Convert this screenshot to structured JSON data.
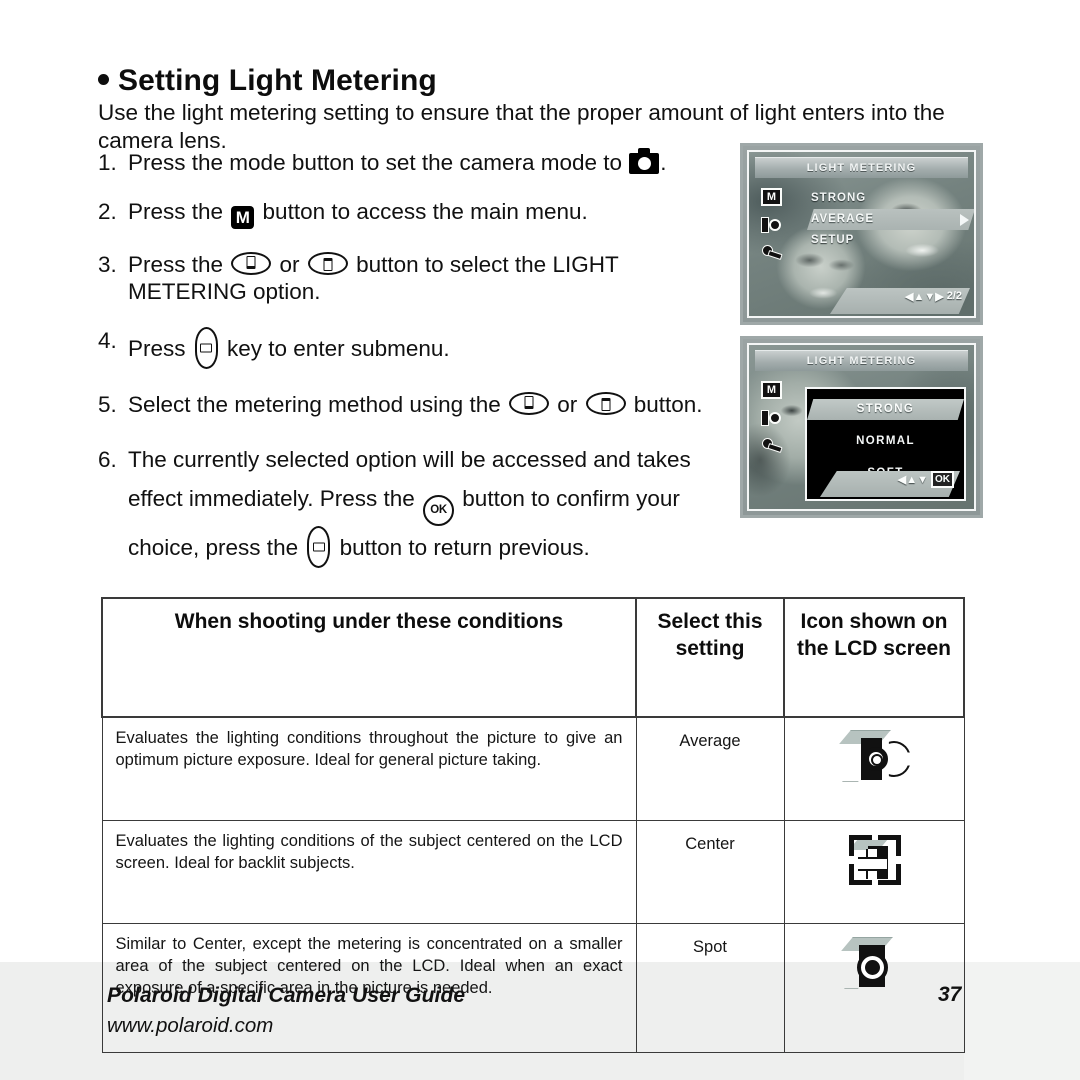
{
  "page": {
    "heading": "Setting Light Metering",
    "intro": "Use the light metering setting to ensure that the proper amount of light enters into the camera lens.",
    "page_number": "37"
  },
  "steps": [
    {
      "number": "1.",
      "text_before": "Press the mode button to set the camera mode to ",
      "icon": "camera-mode-icon",
      "text_after": "."
    },
    {
      "number": "2.",
      "text_before": "Press the ",
      "icon": "mode-m-button-icon",
      "text_after": " button to access the main menu."
    },
    {
      "number": "3.",
      "text_before": "Press the ",
      "icon_a": "zoom-tele-button-icon",
      "text_mid": " or ",
      "icon_b": "zoom-wide-button-icon",
      "text_after": " button to select the LIGHT METERING option."
    },
    {
      "number": "4.",
      "text_before": "Press ",
      "icon": "right-key-icon",
      "text_after": " key to enter submenu."
    },
    {
      "number": "5.",
      "text_before": "Select the metering method using the ",
      "icon_a": "zoom-tele-button-icon",
      "text_mid": " or ",
      "icon_b": "zoom-wide-button-icon",
      "text_after": " button."
    },
    {
      "number": "6.",
      "text_before": "The currently selected option will be accessed and takes effect immediately. Press the ",
      "icon_a": "ok-button-icon",
      "ok_label": "OK",
      "text_mid": " button to confirm your choice, press the ",
      "icon_b": "left-key-icon",
      "text_after": " button to return previous."
    }
  ],
  "lcd_screens": [
    {
      "name": "main-menu",
      "title": "LIGHT METERING",
      "sidebar_icons": [
        "mode-m-icon",
        "metering-icon",
        "setup-wrench-icon"
      ],
      "sidebar_m_label": "M",
      "menu_items": [
        {
          "label": "STRONG",
          "selected": false
        },
        {
          "label": "AVERAGE",
          "selected": true
        },
        {
          "label": "SETUP",
          "selected": false
        }
      ],
      "nav": {
        "arrows": "◀▲▼▶",
        "page": "2/2"
      }
    },
    {
      "name": "submenu",
      "title": "LIGHT METERING",
      "sidebar_icons": [
        "mode-m-icon",
        "metering-icon",
        "setup-wrench-icon"
      ],
      "sidebar_m_label": "M",
      "submenu_items": [
        {
          "label": "STRONG",
          "selected": true
        },
        {
          "label": "NORMAL",
          "selected": false
        },
        {
          "label": "SOFT",
          "selected": false
        }
      ],
      "nav": {
        "arrows": "◀▲▼",
        "ok": "OK"
      }
    }
  ],
  "table": {
    "headers": {
      "conditions": "When shooting under these conditions",
      "setting": "Select this setting",
      "icon": "Icon shown on the LCD screen"
    },
    "rows": [
      {
        "description": "Evaluates the lighting conditions throughout the picture to give an optimum picture exposure. Ideal for general picture taking.",
        "setting": "Average",
        "icon": "average-metering-icon"
      },
      {
        "description": "Evaluates the lighting conditions of the subject centered on the LCD screen. Ideal for backlit subjects.",
        "setting": "Center",
        "icon": "center-metering-icon"
      },
      {
        "description": "Similar to Center, except the metering is concentrated on a smaller area of the subject centered on the LCD. Ideal when an exact exposure of a specific area in the picture is needed.",
        "setting": "Spot",
        "icon": "spot-metering-icon"
      }
    ]
  },
  "footer": {
    "title": "Polaroid Digital Camera User Guide",
    "url": "www.polaroid.com",
    "page": "37"
  }
}
